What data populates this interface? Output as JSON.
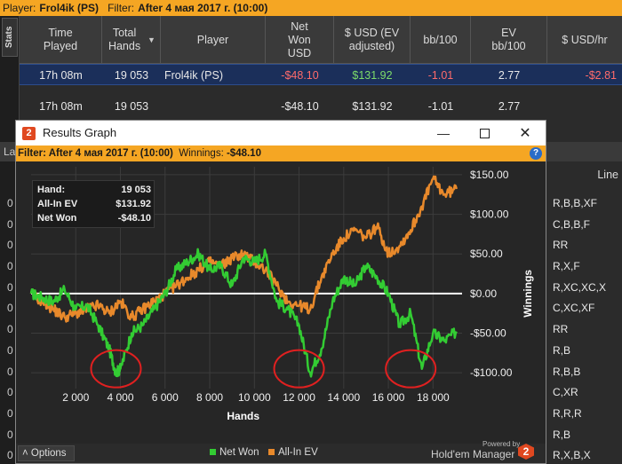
{
  "top_bar": {
    "player_label": "Player:",
    "player_value": "Frol4ik (PS)",
    "filter_label": "Filter:",
    "filter_value": "After 4 мая 2017 г. (10:00)"
  },
  "side_tab": {
    "label": "Stats"
  },
  "table": {
    "headers": [
      "Time Played",
      "Total Hands",
      "Player",
      "Net Won USD",
      "$ USD (EV adjusted)",
      "bb/100",
      "EV bb/100",
      "$ USD/hr"
    ],
    "rows": [
      {
        "time": "17h 08m",
        "hands": "19 053",
        "player": "Frol4ik (PS)",
        "net_won": "-$48.10",
        "ev_adjusted": "$131.92",
        "bb100": "-1.01",
        "ev_bb100": "2.77",
        "usd_hr": "-$2.81"
      },
      {
        "time": "17h 08m",
        "hands": "19 053",
        "player": "",
        "net_won": "-$48.10",
        "ev_adjusted": "$131.92",
        "bb100": "-1.01",
        "ev_bb100": "2.77",
        "usd_hr": ""
      }
    ]
  },
  "background_panel": {
    "left_label": "La",
    "right_header": "Line",
    "left_items": [
      "0",
      "0",
      "0",
      "0",
      "0",
      "0",
      "0",
      "0",
      "0",
      "0",
      "0",
      "0",
      "0"
    ],
    "lines": [
      "R,B,B,XF",
      "C,B,B,F",
      "RR",
      "R,X,F",
      "R,XC,XC,X",
      "C,XC,XF",
      "RR",
      "R,B",
      "R,B,B",
      "C,XR",
      "R,R,R",
      "R,B",
      "R,X,B,X"
    ]
  },
  "graph_window": {
    "title": "Results Graph",
    "filter_text": "Filter: After 4 мая 2017 г. (10:00)",
    "winnings_text": "Winnings:",
    "winnings_value": "-$48.10",
    "info": {
      "hands_label": "Hand:",
      "hands_value": "19 053",
      "allin_label": "All-In EV",
      "allin_value": "$131.92",
      "netwon_label": "Net Won",
      "netwon_value": "-$48.10"
    },
    "options_label": "Options",
    "legend": {
      "net_won": "Net Won",
      "allin_ev": "All-In EV"
    },
    "brand": {
      "powered_by": "Powered by",
      "name": "Hold'em Manager"
    }
  },
  "colors": {
    "accent_orange": "#f5a623",
    "net_won_line": "#33cc33",
    "allin_ev_line": "#e8892b",
    "selected_row": "#1b2f5a",
    "highlight_circle": "#e02020"
  },
  "chart_data": {
    "type": "line",
    "xlabel": "Hands",
    "ylabel": "Winnings",
    "xlim": [
      0,
      19053
    ],
    "ylim": [
      -120,
      160
    ],
    "x_ticks": [
      2000,
      4000,
      6000,
      8000,
      10000,
      12000,
      14000,
      16000,
      18000
    ],
    "x_tick_labels": [
      "2 000",
      "4 000",
      "6 000",
      "8 000",
      "10 000",
      "12 000",
      "14 000",
      "16 000",
      "18 000"
    ],
    "y_ticks": [
      150,
      100,
      50,
      0,
      -50,
      -100
    ],
    "y_tick_labels": [
      "$150.00",
      "$100.00",
      "$50.00",
      "$0.00",
      "-$50.00",
      "-$100.00"
    ],
    "grid": true,
    "legend_position": "bottom",
    "series": [
      {
        "name": "Net Won",
        "color": "#33cc33",
        "x": [
          0,
          500,
          1000,
          1500,
          2000,
          2500,
          3000,
          3500,
          3800,
          4000,
          4500,
          5000,
          5500,
          6000,
          6500,
          7000,
          7500,
          8000,
          8500,
          9000,
          9500,
          10000,
          10500,
          11000,
          11500,
          12000,
          12500,
          13000,
          13500,
          14000,
          14500,
          15000,
          15500,
          16000,
          16500,
          17000,
          17500,
          18000,
          18500,
          19053
        ],
        "y": [
          0,
          -5,
          -10,
          5,
          -20,
          -15,
          -40,
          -70,
          -100,
          -95,
          -50,
          -40,
          -20,
          0,
          30,
          40,
          50,
          30,
          35,
          10,
          45,
          40,
          50,
          -10,
          -20,
          -40,
          -100,
          -70,
          -10,
          20,
          10,
          35,
          20,
          0,
          -40,
          -25,
          -95,
          -50,
          -60,
          -48
        ]
      },
      {
        "name": "All-In EV",
        "color": "#e8892b",
        "x": [
          0,
          500,
          1000,
          1500,
          2000,
          2500,
          3000,
          3500,
          4000,
          4500,
          5000,
          5500,
          6000,
          6500,
          7000,
          7500,
          8000,
          8500,
          9000,
          9500,
          10000,
          10500,
          11000,
          11500,
          12000,
          12500,
          13000,
          13500,
          14000,
          14500,
          15000,
          15500,
          16000,
          16500,
          17000,
          17500,
          18000,
          18500,
          19053
        ],
        "y": [
          0,
          -10,
          -20,
          -30,
          -25,
          -20,
          -15,
          -25,
          -10,
          -30,
          -20,
          -10,
          0,
          10,
          20,
          30,
          40,
          35,
          45,
          50,
          40,
          30,
          10,
          -10,
          -15,
          -20,
          20,
          50,
          70,
          80,
          70,
          85,
          50,
          60,
          80,
          110,
          145,
          125,
          132
        ]
      }
    ],
    "annotations": [
      {
        "type": "circle",
        "x": 3800,
        "y": -95
      },
      {
        "type": "circle",
        "x": 12000,
        "y": -95
      },
      {
        "type": "circle",
        "x": 17000,
        "y": -95
      }
    ]
  }
}
